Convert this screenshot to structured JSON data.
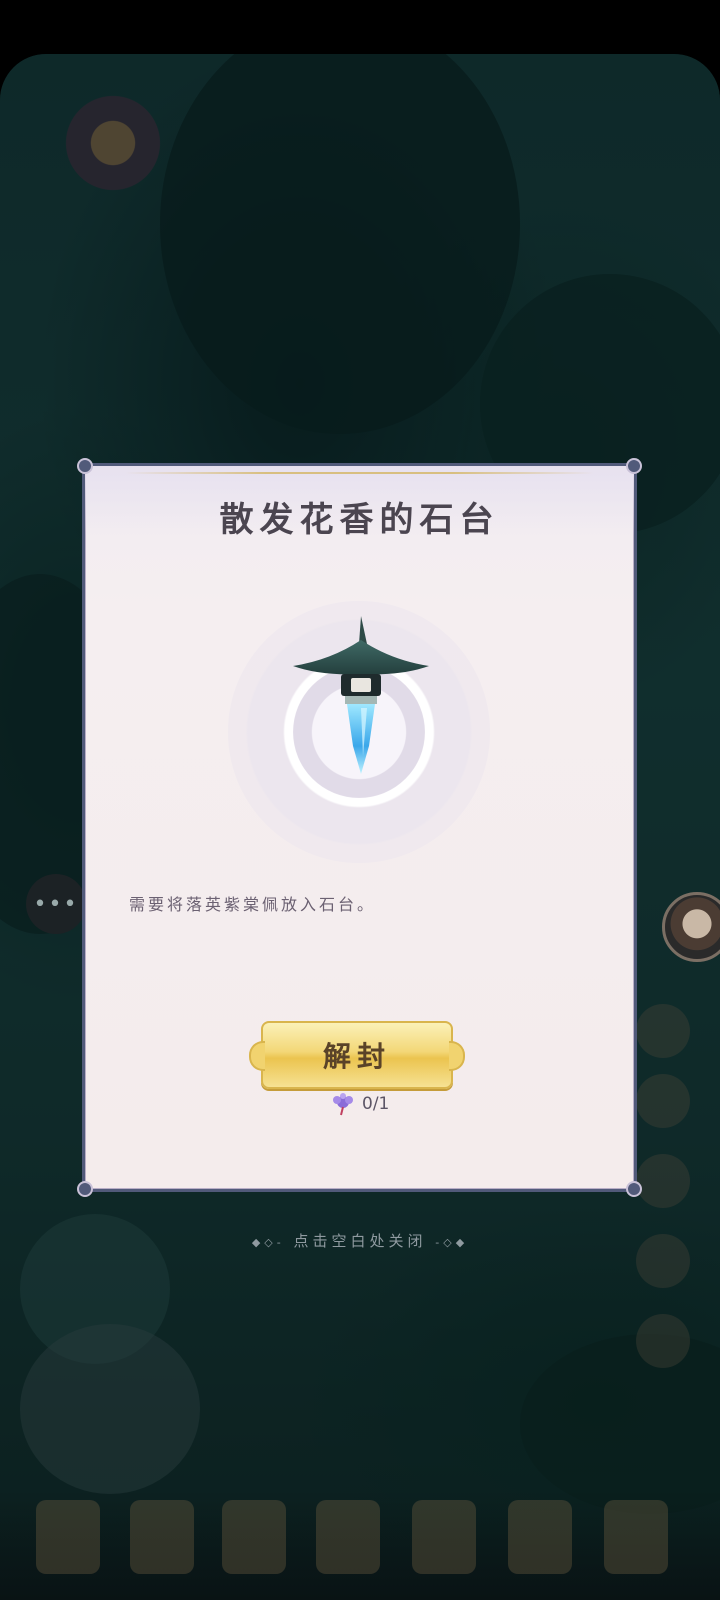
{
  "dialog": {
    "title": "散发花香的石台",
    "item_icon": "stone-lantern-crystal-icon",
    "description": "需要将落英紫棠佩放入石台。",
    "unseal_button": "解封",
    "cost": {
      "icon": "purple-flower-pendant-icon",
      "count": "0/1"
    }
  },
  "close_hint": "点击空白处关闭",
  "hud": {
    "chat_icon": "chat-bubble-icon",
    "avatar_icon": "character-avatar-icon"
  },
  "colors": {
    "dialog_border": "#515a7a",
    "button_gold": "#f3d777",
    "title_text": "#4b4550"
  }
}
